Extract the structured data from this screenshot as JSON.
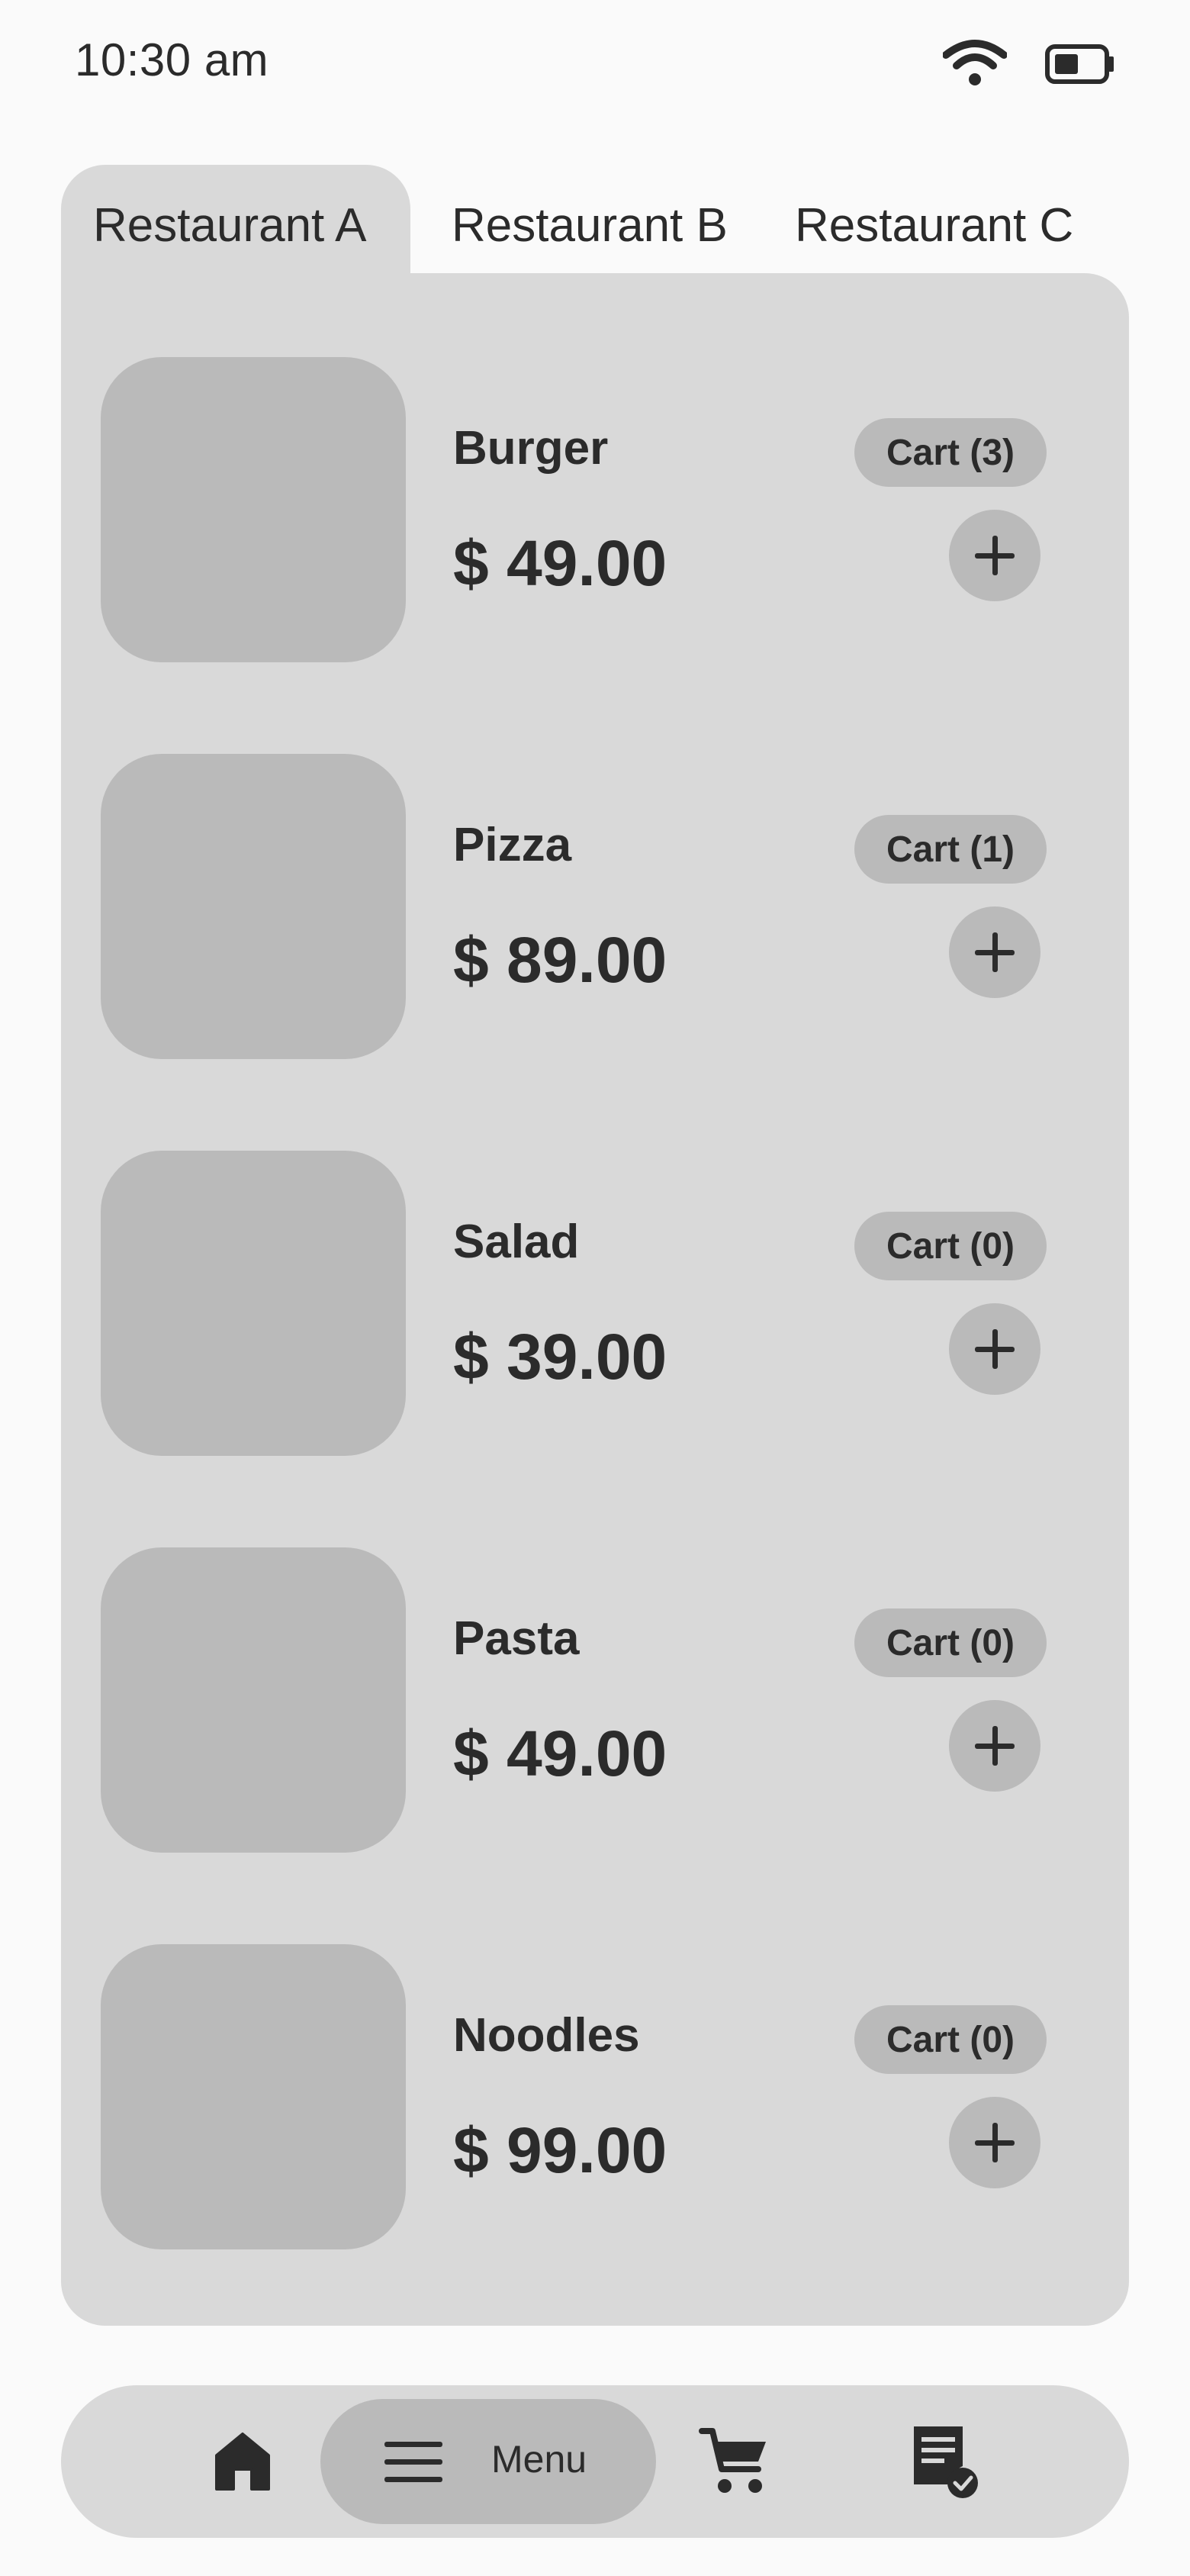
{
  "status_bar": {
    "time": "10:30 am",
    "icons": [
      "wifi-icon",
      "battery-icon"
    ]
  },
  "tabs": [
    {
      "label": "Restaurant A",
      "active": true
    },
    {
      "label": "Restaurant B",
      "active": false
    },
    {
      "label": "Restaurant C",
      "active": false
    }
  ],
  "items": [
    {
      "name": "Burger",
      "price": "$ 49.00",
      "cart": "Cart (3)"
    },
    {
      "name": "Pizza",
      "price": "$ 89.00",
      "cart": "Cart (1)"
    },
    {
      "name": "Salad",
      "price": "$ 39.00",
      "cart": "Cart (0)"
    },
    {
      "name": "Pasta",
      "price": "$ 49.00",
      "cart": "Cart (0)"
    },
    {
      "name": "Noodles",
      "price": "$ 99.00",
      "cart": "Cart (0)"
    }
  ],
  "bottom_nav": {
    "items": [
      {
        "icon": "home-icon"
      },
      {
        "icon": "menu-icon",
        "label": "Menu",
        "active": true
      },
      {
        "icon": "cart-icon"
      },
      {
        "icon": "orders-icon"
      }
    ]
  },
  "colors": {
    "background": "#fafafa",
    "panel": "#d9d9d9",
    "placeholder": "#bababa",
    "text": "#2b2b2b"
  }
}
